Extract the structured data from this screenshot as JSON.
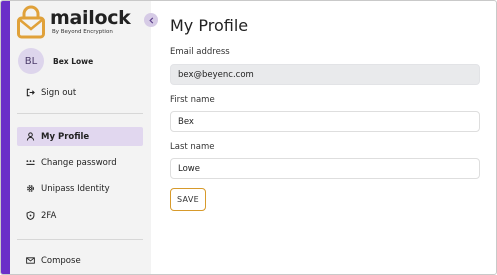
{
  "brand": {
    "name": "mailock",
    "tagline": "By Beyond Encryption",
    "accent": "#6a2fc8",
    "logo_color": "#e0a13a"
  },
  "user": {
    "initials": "BL",
    "name": "Bex Lowe"
  },
  "sidebar": {
    "sign_out": {
      "label": "Sign out",
      "icon": "sign-out-icon"
    },
    "items": [
      {
        "label": "My Profile",
        "icon": "person-icon",
        "active": true
      },
      {
        "label": "Change password",
        "icon": "dots-icon",
        "active": false
      },
      {
        "label": "Unipass Identity",
        "icon": "gear-icon",
        "active": false
      },
      {
        "label": "2FA",
        "icon": "shield-icon",
        "active": false
      }
    ],
    "compose": {
      "label": "Compose",
      "icon": "mail-icon"
    }
  },
  "main": {
    "title": "My Profile",
    "email": {
      "label": "Email address",
      "value": "bex@beyenc.com",
      "disabled": true
    },
    "first_name": {
      "label": "First name",
      "value": "Bex"
    },
    "last_name": {
      "label": "Last name",
      "value": "Lowe"
    },
    "save_label": "SAVE"
  }
}
